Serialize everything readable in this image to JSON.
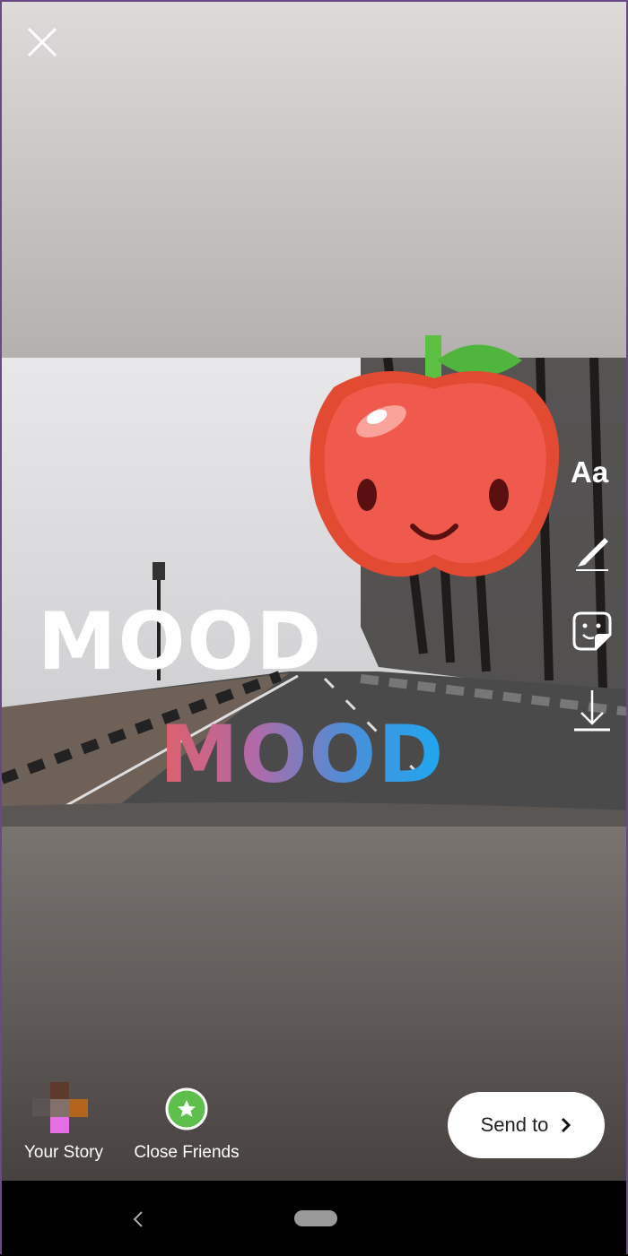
{
  "editor": {
    "tools": {
      "text_label": "Aa",
      "draw_icon": "pen-icon",
      "sticker_icon": "sticker-icon",
      "save_icon": "download-icon"
    },
    "close_icon": "close-icon",
    "stickers": [
      {
        "type": "apple-sticker"
      },
      {
        "text": "MOOD",
        "style": "white"
      },
      {
        "text": "MOOD",
        "style": "gradient"
      }
    ]
  },
  "share": {
    "your_story_label": "Your Story",
    "close_friends_label": "Close Friends",
    "close_friends_color": "#5cc04a",
    "send_label": "Send to"
  },
  "navbar": {
    "back_icon": "back-chevron-icon",
    "home_icon": "home-pill-icon"
  }
}
